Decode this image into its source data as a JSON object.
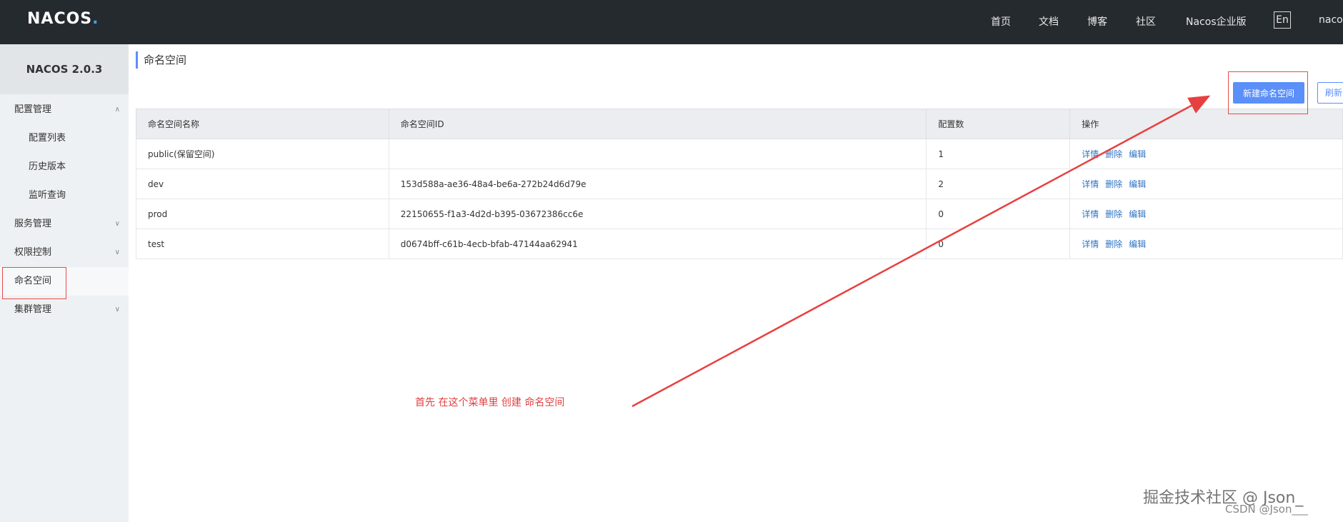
{
  "header": {
    "logo": "NACOS",
    "logo_dot": ".",
    "nav": [
      "首页",
      "文档",
      "博客",
      "社区",
      "Nacos企业版"
    ],
    "lang": "En",
    "user": "nacos"
  },
  "sidebar": {
    "title": "NACOS 2.0.3",
    "items": [
      {
        "label": "配置管理",
        "chevron": "up"
      },
      {
        "label": "配置列表"
      },
      {
        "label": "历史版本"
      },
      {
        "label": "监听查询"
      },
      {
        "label": "服务管理",
        "chevron": "down"
      },
      {
        "label": "权限控制",
        "chevron": "down"
      },
      {
        "label": "命名空间",
        "active": true
      },
      {
        "label": "集群管理",
        "chevron": "down"
      }
    ]
  },
  "main": {
    "title": "命名空间",
    "new_button": "新建命名空间",
    "refresh_button": "刷新",
    "table": {
      "headers": [
        "命名空间名称",
        "命名空间ID",
        "配置数",
        "操作"
      ],
      "rows": [
        {
          "name": "public(保留空间)",
          "id": "",
          "count": "1",
          "ops": [
            "详情",
            "删除",
            "编辑"
          ]
        },
        {
          "name": "dev",
          "id": "153d588a-ae36-48a4-be6a-272b24d6d79e",
          "count": "2",
          "ops": [
            "详情",
            "删除",
            "编辑"
          ]
        },
        {
          "name": "prod",
          "id": "22150655-f1a3-4d2d-b395-03672386cc6e",
          "count": "0",
          "ops": [
            "详情",
            "删除",
            "编辑"
          ]
        },
        {
          "name": "test",
          "id": "d0674bff-c61b-4ecb-bfab-47144aa62941",
          "count": "0",
          "ops": [
            "详情",
            "删除",
            "编辑"
          ]
        }
      ]
    }
  },
  "annotation": {
    "note": "首先 在这个菜单里 创建 命名空间",
    "color": "#e84040"
  },
  "watermark": {
    "big": "掘金技术社区 @ Json_",
    "small": "CSDN @Json___"
  },
  "colors": {
    "topbar": "#252a2f",
    "accent": "#5b8ff9",
    "link": "#2f74c4",
    "sidebar": "#eef1f3"
  }
}
